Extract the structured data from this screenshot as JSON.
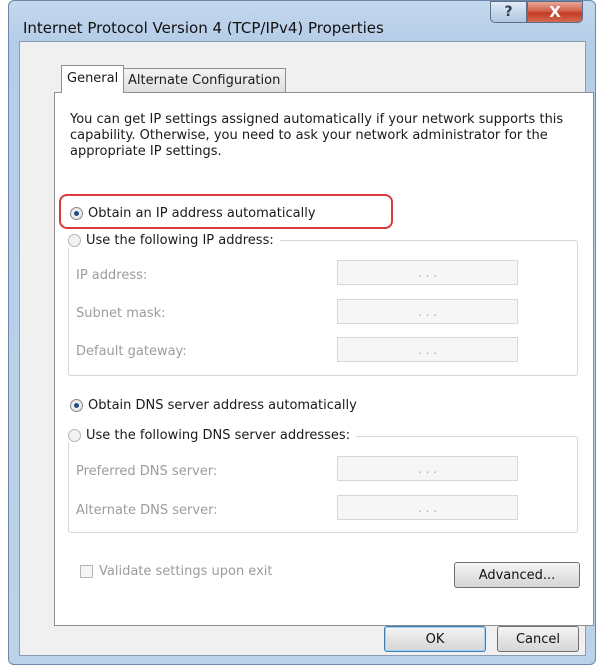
{
  "window": {
    "title": "Internet Protocol Version 4 (TCP/IPv4) Properties",
    "help_glyph": "?",
    "close_glyph": "X"
  },
  "tabs": [
    {
      "label": "General",
      "selected": true
    },
    {
      "label": "Alternate Configuration",
      "selected": false
    }
  ],
  "general": {
    "description": "You can get IP settings assigned automatically if your network supports this capability. Otherwise, you need to ask your network administrator for the appropriate IP settings.",
    "ip_auto_label": "Obtain an IP address automatically",
    "ip_manual_label": "Use the following IP address:",
    "ip_fields": [
      {
        "label": "IP address:",
        "value": ". . ."
      },
      {
        "label": "Subnet mask:",
        "value": ". . ."
      },
      {
        "label": "Default gateway:",
        "value": ". . ."
      }
    ],
    "dns_auto_label": "Obtain DNS server address automatically",
    "dns_manual_label": "Use the following DNS server addresses:",
    "dns_fields": [
      {
        "label": "Preferred DNS server:",
        "value": ". . ."
      },
      {
        "label": "Alternate DNS server:",
        "value": ". . ."
      }
    ],
    "validate_label": "Validate settings upon exit",
    "advanced_label": "Advanced..."
  },
  "footer": {
    "ok_label": "OK",
    "cancel_label": "Cancel"
  },
  "colors": {
    "highlight": "#d83b3b",
    "radio_dot": "#1f4e8c"
  }
}
